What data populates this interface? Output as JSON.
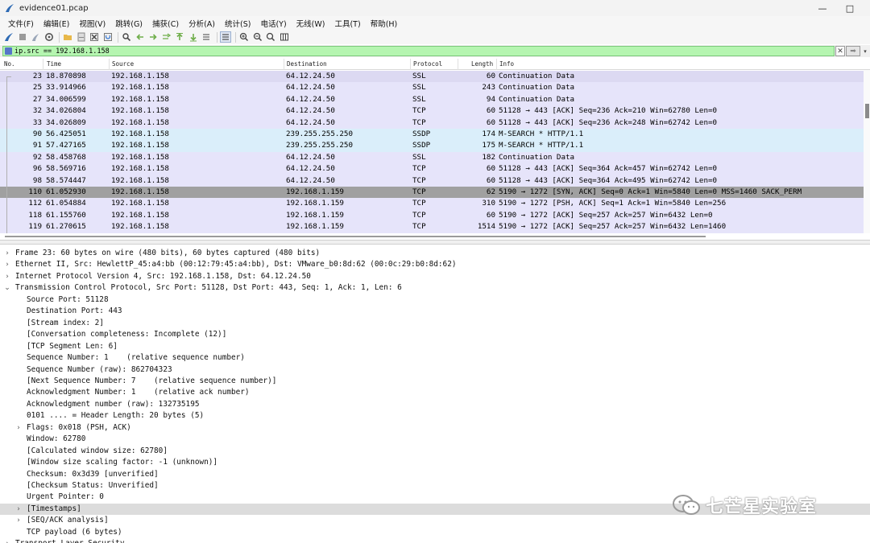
{
  "window": {
    "title": "evidence01.pcap",
    "minimize": "—",
    "maximize": "□"
  },
  "menu": [
    "文件(F)",
    "编辑(E)",
    "视图(V)",
    "跳转(G)",
    "捕获(C)",
    "分析(A)",
    "统计(S)",
    "电话(Y)",
    "无线(W)",
    "工具(T)",
    "帮助(H)"
  ],
  "toolbar": {
    "icons": [
      "shark-fin-start-icon",
      "stop-icon",
      "restart-icon",
      "options-gear-icon",
      "open-folder-icon",
      "save-file-icon",
      "close-file-icon",
      "reload-icon",
      "find-icon",
      "back-arrow-icon",
      "forward-arrow-icon",
      "go-to-packet-icon",
      "first-packet-icon",
      "last-packet-icon",
      "autoscroll-icon",
      "colorize-icon",
      "zoom-in-icon",
      "zoom-out-icon",
      "normal-size-icon",
      "resize-columns-icon"
    ]
  },
  "filter": {
    "value": "ip.src == 192.168.1.158"
  },
  "packet_list": {
    "columns": [
      "No.",
      "Time",
      "Source",
      "Destination",
      "Protocol",
      "Length",
      "Info"
    ],
    "rows": [
      {
        "no": "23",
        "time": "18.870898",
        "src": "192.168.1.158",
        "dst": "64.12.24.50",
        "proto": "SSL",
        "len": "60",
        "info": "Continuation Data",
        "color": "#dcd9f2"
      },
      {
        "no": "25",
        "time": "33.914966",
        "src": "192.168.1.158",
        "dst": "64.12.24.50",
        "proto": "SSL",
        "len": "243",
        "info": "Continuation Data",
        "color": "#e6e4fa"
      },
      {
        "no": "27",
        "time": "34.006599",
        "src": "192.168.1.158",
        "dst": "64.12.24.50",
        "proto": "SSL",
        "len": "94",
        "info": "Continuation Data",
        "color": "#e6e4fa"
      },
      {
        "no": "32",
        "time": "34.026804",
        "src": "192.168.1.158",
        "dst": "64.12.24.50",
        "proto": "TCP",
        "len": "60",
        "info": "51128 → 443 [ACK] Seq=236 Ack=210 Win=62780 Len=0",
        "color": "#e6e4fa"
      },
      {
        "no": "33",
        "time": "34.026809",
        "src": "192.168.1.158",
        "dst": "64.12.24.50",
        "proto": "TCP",
        "len": "60",
        "info": "51128 → 443 [ACK] Seq=236 Ack=248 Win=62742 Len=0",
        "color": "#e6e4fa"
      },
      {
        "no": "90",
        "time": "56.425051",
        "src": "192.168.1.158",
        "dst": "239.255.255.250",
        "proto": "SSDP",
        "len": "174",
        "info": "M-SEARCH * HTTP/1.1",
        "color": "#daeefa"
      },
      {
        "no": "91",
        "time": "57.427165",
        "src": "192.168.1.158",
        "dst": "239.255.255.250",
        "proto": "SSDP",
        "len": "175",
        "info": "M-SEARCH * HTTP/1.1",
        "color": "#daeefa"
      },
      {
        "no": "92",
        "time": "58.458768",
        "src": "192.168.1.158",
        "dst": "64.12.24.50",
        "proto": "SSL",
        "len": "182",
        "info": "Continuation Data",
        "color": "#e6e4fa"
      },
      {
        "no": "96",
        "time": "58.569716",
        "src": "192.168.1.158",
        "dst": "64.12.24.50",
        "proto": "TCP",
        "len": "60",
        "info": "51128 → 443 [ACK] Seq=364 Ack=457 Win=62742 Len=0",
        "color": "#e6e4fa"
      },
      {
        "no": "98",
        "time": "58.574447",
        "src": "192.168.1.158",
        "dst": "64.12.24.50",
        "proto": "TCP",
        "len": "60",
        "info": "51128 → 443 [ACK] Seq=364 Ack=495 Win=62742 Len=0",
        "color": "#e6e4fa"
      },
      {
        "no": "110",
        "time": "61.052930",
        "src": "192.168.1.158",
        "dst": "192.168.1.159",
        "proto": "TCP",
        "len": "62",
        "info": "5190 → 1272 [SYN, ACK] Seq=0 Ack=1 Win=5840 Len=0 MSS=1460 SACK_PERM",
        "color": "#a0a0a0"
      },
      {
        "no": "112",
        "time": "61.054884",
        "src": "192.168.1.158",
        "dst": "192.168.1.159",
        "proto": "TCP",
        "len": "310",
        "info": "5190 → 1272 [PSH, ACK] Seq=1 Ack=1 Win=5840 Len=256",
        "color": "#e6e4fa"
      },
      {
        "no": "118",
        "time": "61.155760",
        "src": "192.168.1.158",
        "dst": "192.168.1.159",
        "proto": "TCP",
        "len": "60",
        "info": "5190 → 1272 [ACK] Seq=257 Ack=257 Win=6432 Len=0",
        "color": "#e6e4fa"
      },
      {
        "no": "119",
        "time": "61.270615",
        "src": "192.168.1.158",
        "dst": "192.168.1.159",
        "proto": "TCP",
        "len": "1514",
        "info": "5190 → 1272 [ACK] Seq=257 Ack=257 Win=6432 Len=1460",
        "color": "#e6e4fa"
      }
    ]
  },
  "details": [
    {
      "indent": 0,
      "arrow": "›",
      "text": "Frame 23: 60 bytes on wire (480 bits), 60 bytes captured (480 bits)"
    },
    {
      "indent": 0,
      "arrow": "›",
      "text": "Ethernet II, Src: HewlettP_45:a4:bb (00:12:79:45:a4:bb), Dst: VMware_b0:8d:62 (00:0c:29:b0:8d:62)"
    },
    {
      "indent": 0,
      "arrow": "›",
      "text": "Internet Protocol Version 4, Src: 192.168.1.158, Dst: 64.12.24.50"
    },
    {
      "indent": 0,
      "arrow": "⌄",
      "text": "Transmission Control Protocol, Src Port: 51128, Dst Port: 443, Seq: 1, Ack: 1, Len: 6"
    },
    {
      "indent": 1,
      "arrow": "",
      "text": "Source Port: 51128"
    },
    {
      "indent": 1,
      "arrow": "",
      "text": "Destination Port: 443"
    },
    {
      "indent": 1,
      "arrow": "",
      "text": "[Stream index: 2]"
    },
    {
      "indent": 1,
      "arrow": "",
      "text": "[Conversation completeness: Incomplete (12)]"
    },
    {
      "indent": 1,
      "arrow": "",
      "text": "[TCP Segment Len: 6]"
    },
    {
      "indent": 1,
      "arrow": "",
      "text": "Sequence Number: 1    (relative sequence number)"
    },
    {
      "indent": 1,
      "arrow": "",
      "text": "Sequence Number (raw): 862704323"
    },
    {
      "indent": 1,
      "arrow": "",
      "text": "[Next Sequence Number: 7    (relative sequence number)]"
    },
    {
      "indent": 1,
      "arrow": "",
      "text": "Acknowledgment Number: 1    (relative ack number)"
    },
    {
      "indent": 1,
      "arrow": "",
      "text": "Acknowledgment number (raw): 132735195"
    },
    {
      "indent": 1,
      "arrow": "",
      "text": "0101 .... = Header Length: 20 bytes (5)"
    },
    {
      "indent": 1,
      "arrow": "›",
      "text": "Flags: 0x018 (PSH, ACK)"
    },
    {
      "indent": 1,
      "arrow": "",
      "text": "Window: 62780"
    },
    {
      "indent": 1,
      "arrow": "",
      "text": "[Calculated window size: 62780]"
    },
    {
      "indent": 1,
      "arrow": "",
      "text": "[Window size scaling factor: -1 (unknown)]"
    },
    {
      "indent": 1,
      "arrow": "",
      "text": "Checksum: 0x3d39 [unverified]"
    },
    {
      "indent": 1,
      "arrow": "",
      "text": "[Checksum Status: Unverified]"
    },
    {
      "indent": 1,
      "arrow": "",
      "text": "Urgent Pointer: 0"
    },
    {
      "indent": 1,
      "arrow": "›",
      "text": "[Timestamps]",
      "highlight": true
    },
    {
      "indent": 1,
      "arrow": "›",
      "text": "[SEQ/ACK analysis]"
    },
    {
      "indent": 1,
      "arrow": "",
      "text": "TCP payload (6 bytes)"
    },
    {
      "indent": 0,
      "arrow": "›",
      "text": "Transport Layer Security"
    }
  ],
  "watermark": {
    "text": "七芒星实验室"
  },
  "colors": {
    "filter_bg": "#b5f5b0",
    "selected_row": "#a0a0a0",
    "tcp_row": "#e6e4fa",
    "ssdp_row": "#daeefa"
  }
}
